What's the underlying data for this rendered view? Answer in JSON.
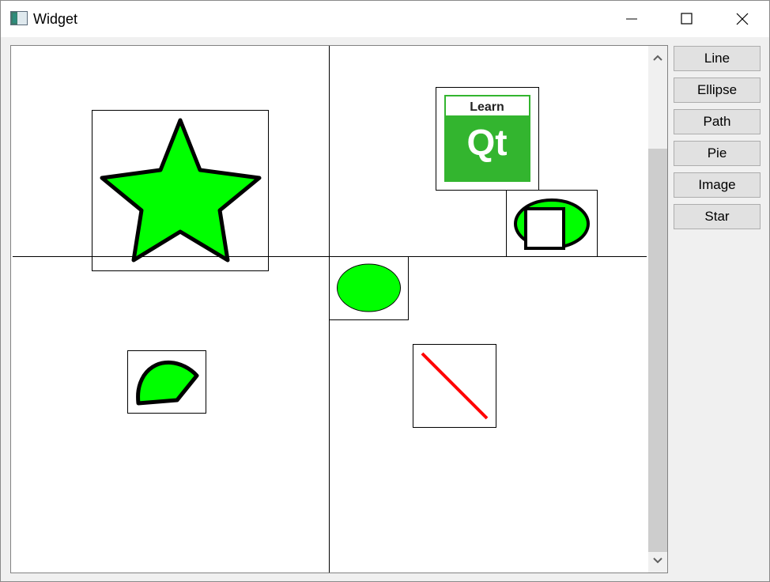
{
  "window": {
    "title": "Widget"
  },
  "buttons": [
    "Line",
    "Ellipse",
    "Path",
    "Pie",
    "Image",
    "Star"
  ],
  "image_text": {
    "top": "Learn",
    "bottom": "Qt"
  },
  "colors": {
    "fill": "#00ff00",
    "stroke": "#000000",
    "line": "#ff0000",
    "qt_green": "#33b52f"
  }
}
